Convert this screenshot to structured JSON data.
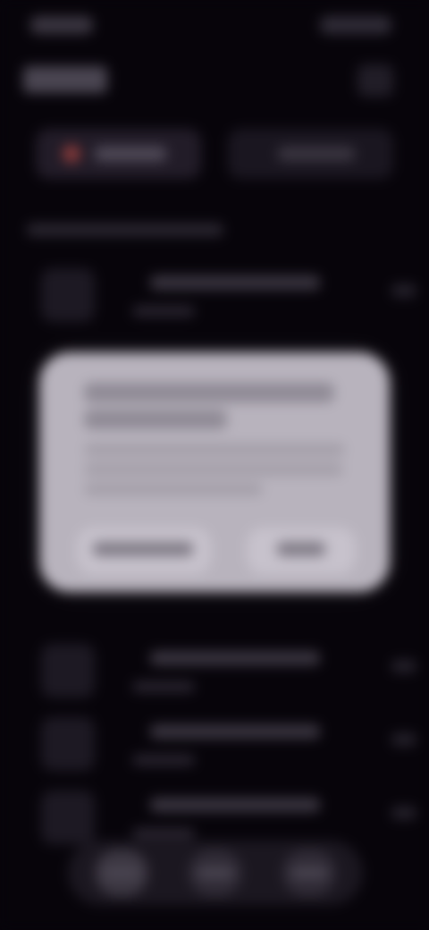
{
  "status_bar": {
    "time": "",
    "icons": ""
  },
  "header": {
    "title": "",
    "action_icon": "more-icon"
  },
  "tabs": [
    {
      "label": "",
      "icon": "record-icon",
      "active": true
    },
    {
      "label": "",
      "active": false
    }
  ],
  "section": {
    "label": ""
  },
  "list_items": [
    {
      "title": "",
      "subtitle": "",
      "meta": ""
    },
    {
      "title": "",
      "subtitle": "",
      "meta": ""
    },
    {
      "title": "",
      "subtitle": "",
      "meta": ""
    },
    {
      "title": "",
      "subtitle": "",
      "meta": ""
    }
  ],
  "bottom_nav": [
    {
      "label": ""
    },
    {
      "label": ""
    },
    {
      "label": ""
    }
  ],
  "dialog": {
    "title": "",
    "body": "",
    "cancel_label": "",
    "confirm_label": ""
  },
  "colors": {
    "background": "#07040a",
    "dialog_background": "#b8b3bd",
    "accent": "#8a3b3b"
  }
}
